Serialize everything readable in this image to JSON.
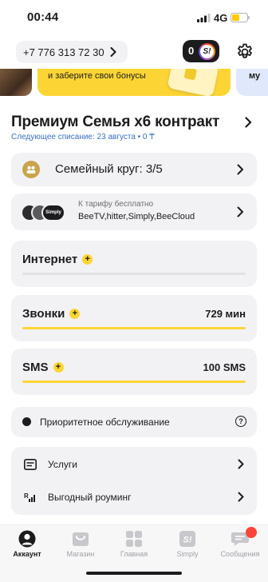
{
  "status_bar": {
    "time": "00:44",
    "network": "4G"
  },
  "header": {
    "phone_number": "+7 776 313 72 30",
    "coins": "0",
    "simply_badge": "S!"
  },
  "banners": {
    "promo_text": "и заберите свои бонусы",
    "right_text": "му"
  },
  "tariff": {
    "name": "Премиум Семья x6 контракт",
    "next_charge": "Следующее списание: 23 августа • 0 ₸"
  },
  "family": {
    "label": "Семейный круг: 3/5"
  },
  "bonus_services": {
    "caption": "К тарифу бесплатно",
    "services": "BeeTV,hitter,Simply,BeeCloud",
    "logos": [
      {
        "name": "beetv-logo",
        "color": "#2c2c2e",
        "text": ""
      },
      {
        "name": "hitter-logo",
        "color": "#5a5a5e",
        "text": ""
      },
      {
        "name": "simply-logo",
        "color": "#1c1c1e",
        "text": "Simply"
      }
    ]
  },
  "usage": {
    "internet": {
      "label": "Интернет",
      "value": "",
      "fill_fraction": 0
    },
    "calls": {
      "label": "Звонки",
      "value": "729 мин",
      "fill_fraction": 1
    },
    "sms": {
      "label": "SMS",
      "value": "100 SMS",
      "fill_fraction": 1
    }
  },
  "priority": {
    "label": "Приоритетное обслуживание",
    "help_glyph": "?"
  },
  "menu": {
    "services_label": "Услуги",
    "roaming_label": "Выгодный роуминг"
  },
  "tabs": [
    {
      "label": "Аккаунт",
      "icon": "account-icon",
      "active": true
    },
    {
      "label": "Магазин",
      "icon": "shop-icon",
      "active": false
    },
    {
      "label": "Главная",
      "icon": "home-grid-icon",
      "active": false
    },
    {
      "label": "Simply",
      "icon": "simply-tab-icon",
      "active": false
    },
    {
      "label": "Сообщения",
      "icon": "messages-icon",
      "active": false
    }
  ],
  "colors": {
    "accent_yellow": "#fcd535",
    "card_bg": "#f2f2f4",
    "link_blue": "#3a6fc4",
    "notification_red": "#ff453a"
  }
}
